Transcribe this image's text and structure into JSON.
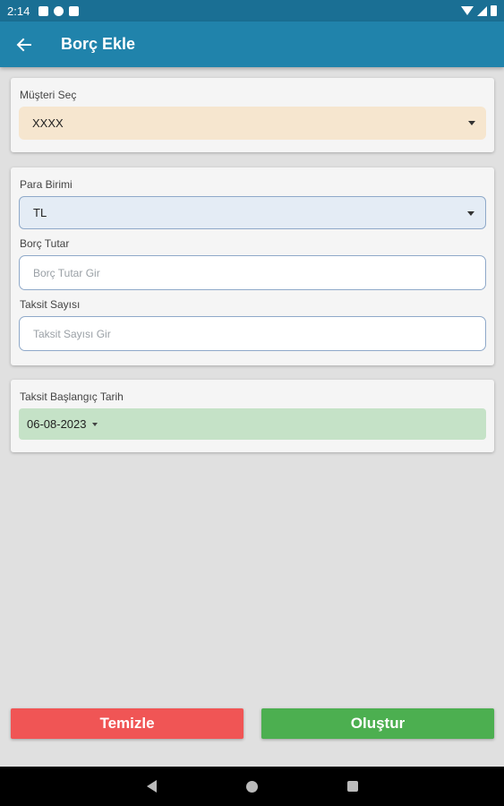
{
  "status_bar": {
    "time": "2:14"
  },
  "app_bar": {
    "back_icon": "arrow-left-icon",
    "title": "Borç Ekle"
  },
  "customer_card": {
    "label": "Müşteri Seç",
    "selected": "XXXX"
  },
  "debt_card": {
    "currency_label": "Para Birimi",
    "currency_selected": "TL",
    "amount_label": "Borç Tutar",
    "amount_placeholder": "Borç Tutar Gir",
    "amount_value": "",
    "installments_label": "Taksit Sayısı",
    "installments_placeholder": "Taksit Sayısı Gir",
    "installments_value": ""
  },
  "date_card": {
    "label": "Taksit Başlangıç Tarih",
    "value": "06-08-2023"
  },
  "buttons": {
    "clear": "Temizle",
    "create": "Oluştur"
  },
  "colors": {
    "app_bar": "#2083ab",
    "status_bar": "#1a6f94",
    "customer_dropdown_bg": "#f6e6cf",
    "currency_dropdown_bg": "#e4ecf5",
    "date_bg": "#c5e2c7",
    "clear_button": "#f05555",
    "create_button": "#4caf50"
  }
}
